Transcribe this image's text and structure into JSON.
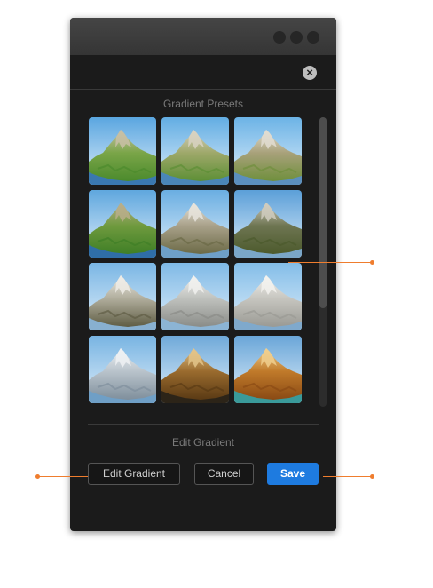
{
  "window": {
    "close_icon_glyph": "×"
  },
  "presets": {
    "title": "Gradient Presets",
    "items": [
      {
        "sky": "#5aa6e0",
        "low": "#4b8a2c",
        "high": "#7aa548",
        "peak": "#c9c0a6",
        "water": "#3a78b0"
      },
      {
        "sky": "#62ade3",
        "low": "#5d8f35",
        "high": "#9ea86a",
        "peak": "#d8d2c2",
        "water": "#4a86b8"
      },
      {
        "sky": "#6cb3e6",
        "low": "#6f8f3c",
        "high": "#a8a17a",
        "peak": "#e2ddd2",
        "water": "#5b8fbe"
      },
      {
        "sky": "#5fa7de",
        "low": "#3f7f26",
        "high": "#6f9a3e",
        "peak": "#b9ae8a",
        "water": "#2f6ea8"
      },
      {
        "sky": "#6aaee2",
        "low": "#6b6a46",
        "high": "#a9a18a",
        "peak": "#e7e4dc",
        "water": "#6e9fc8"
      },
      {
        "sky": "#5b9fd8",
        "low": "#4c5a2c",
        "high": "#6e7552",
        "peak": "#d0ccc0",
        "water": "#7aa6c8"
      },
      {
        "sky": "#7ab6e4",
        "low": "#5f5d44",
        "high": "#b0ad9c",
        "peak": "#eeece6",
        "water": "#88b0d0"
      },
      {
        "sky": "#7fb9e6",
        "low": "#8a8c88",
        "high": "#bfc1bd",
        "peak": "#f1f1ef",
        "water": "#8cb4d4"
      },
      {
        "sky": "#83bde8",
        "low": "#9a9a94",
        "high": "#c6c5bf",
        "peak": "#f3f2ee",
        "water": "#7fa9cc"
      },
      {
        "sky": "#78b4e2",
        "low": "#7f8f9c",
        "high": "#b9c3cb",
        "peak": "#eef1f3",
        "water": "#6f9fc6"
      },
      {
        "sky": "#6fa9d9",
        "low": "#5a3a14",
        "high": "#9a6b2e",
        "peak": "#e3c48a",
        "water": "#2c2418"
      },
      {
        "sky": "#6aa6d8",
        "low": "#8a4a14",
        "high": "#c07a2a",
        "peak": "#f0cf8e",
        "water": "#3a9a9a"
      }
    ]
  },
  "edit": {
    "title": "Edit Gradient"
  },
  "buttons": {
    "edit_gradient": "Edit Gradient",
    "cancel": "Cancel",
    "save": "Save"
  },
  "colors": {
    "accent_blue": "#1e7be0",
    "callout_orange": "#ef7d2e",
    "window_bg": "#1b1b1b"
  }
}
